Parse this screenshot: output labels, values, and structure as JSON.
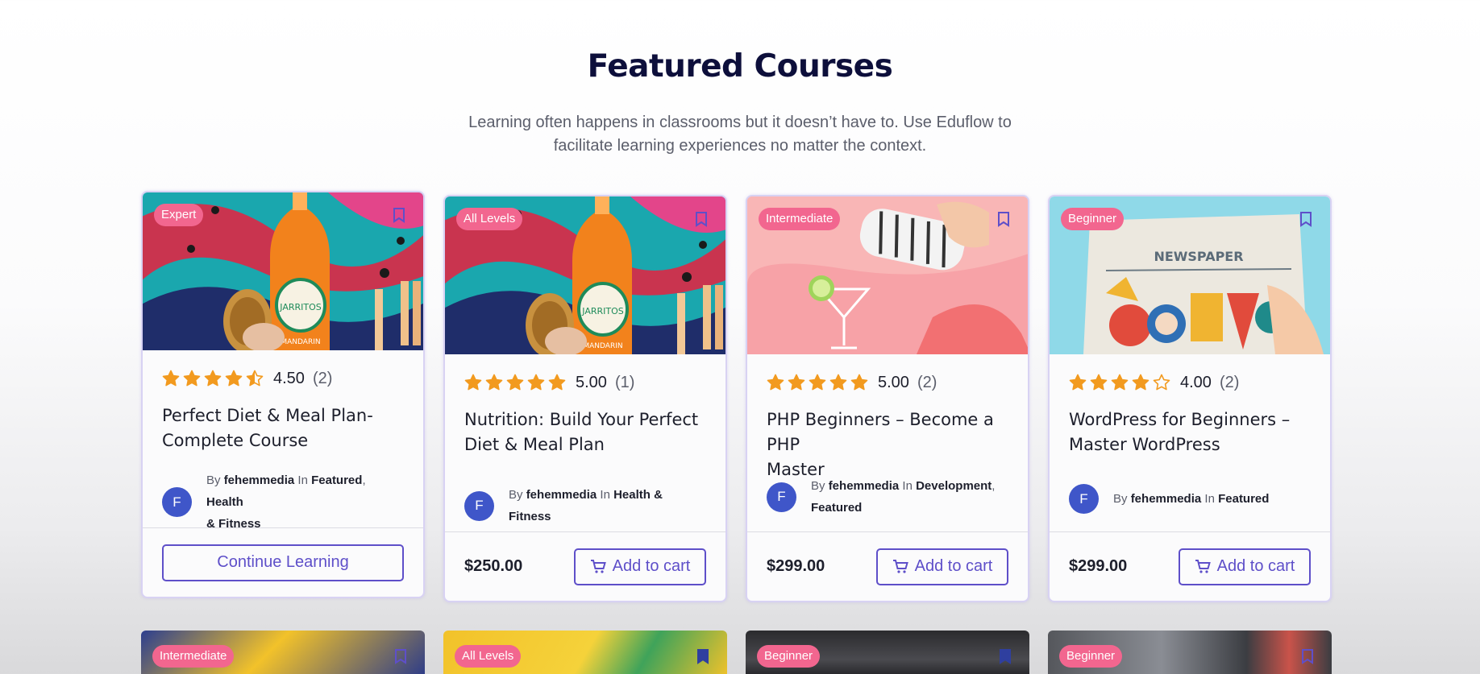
{
  "section": {
    "title": "Featured Courses",
    "subtitle_line1": "Learning often happens in classrooms but it doesn’t have to. Use Eduflow to",
    "subtitle_line2": "facilitate learning experiences no matter the context."
  },
  "labels": {
    "by": "By",
    "in": "In"
  },
  "courses": [
    {
      "level": "Expert",
      "stars": 4.5,
      "rating": "4.50",
      "count": "(2)",
      "title_line1": "Perfect Diet & Meal Plan-",
      "title_line2": "Complete Course",
      "author": "fehemmedia",
      "cat1": "Featured",
      "cat2": "Health",
      "cat2b": "& Fitness",
      "action": "Continue Learning",
      "avatar": "F"
    },
    {
      "level": "All Levels",
      "stars": 5,
      "rating": "5.00",
      "count": "(1)",
      "title_line1": "Nutrition: Build Your Perfect",
      "title_line2": "Diet & Meal Plan",
      "author": "fehemmedia",
      "cat1": "Health & Fitness",
      "price": "$250.00",
      "action": "Add to cart",
      "avatar": "F"
    },
    {
      "level": "Intermediate",
      "stars": 5,
      "rating": "5.00",
      "count": "(2)",
      "title_line1": "PHP Beginners – Become a PHP",
      "title_line2": "Master",
      "author": "fehemmedia",
      "cat1": "Development",
      "cat2": "Featured",
      "price": "$299.00",
      "action": "Add to cart",
      "avatar": "F"
    },
    {
      "level": "Beginner",
      "stars": 4,
      "rating": "4.00",
      "count": "(2)",
      "title_line1": "WordPress for Beginners –",
      "title_line2": "Master WordPress",
      "author": "fehemmedia",
      "cat1": "Featured",
      "price": "$299.00",
      "action": "Add to cart",
      "avatar": "F"
    }
  ],
  "row2_levels": [
    "Intermediate",
    "All Levels",
    "Beginner",
    "Beginner"
  ],
  "thumb_text": {
    "bottle_label": "JARRITOS",
    "bottle_sub": "MANDARIN",
    "newspaper": "NEWSPAPER"
  },
  "colors": {
    "accent": "#5e4fc9",
    "badge": "#f2668f",
    "star": "#f29a1f",
    "avatar": "#3f56c9",
    "title": "#0d0f3b"
  }
}
